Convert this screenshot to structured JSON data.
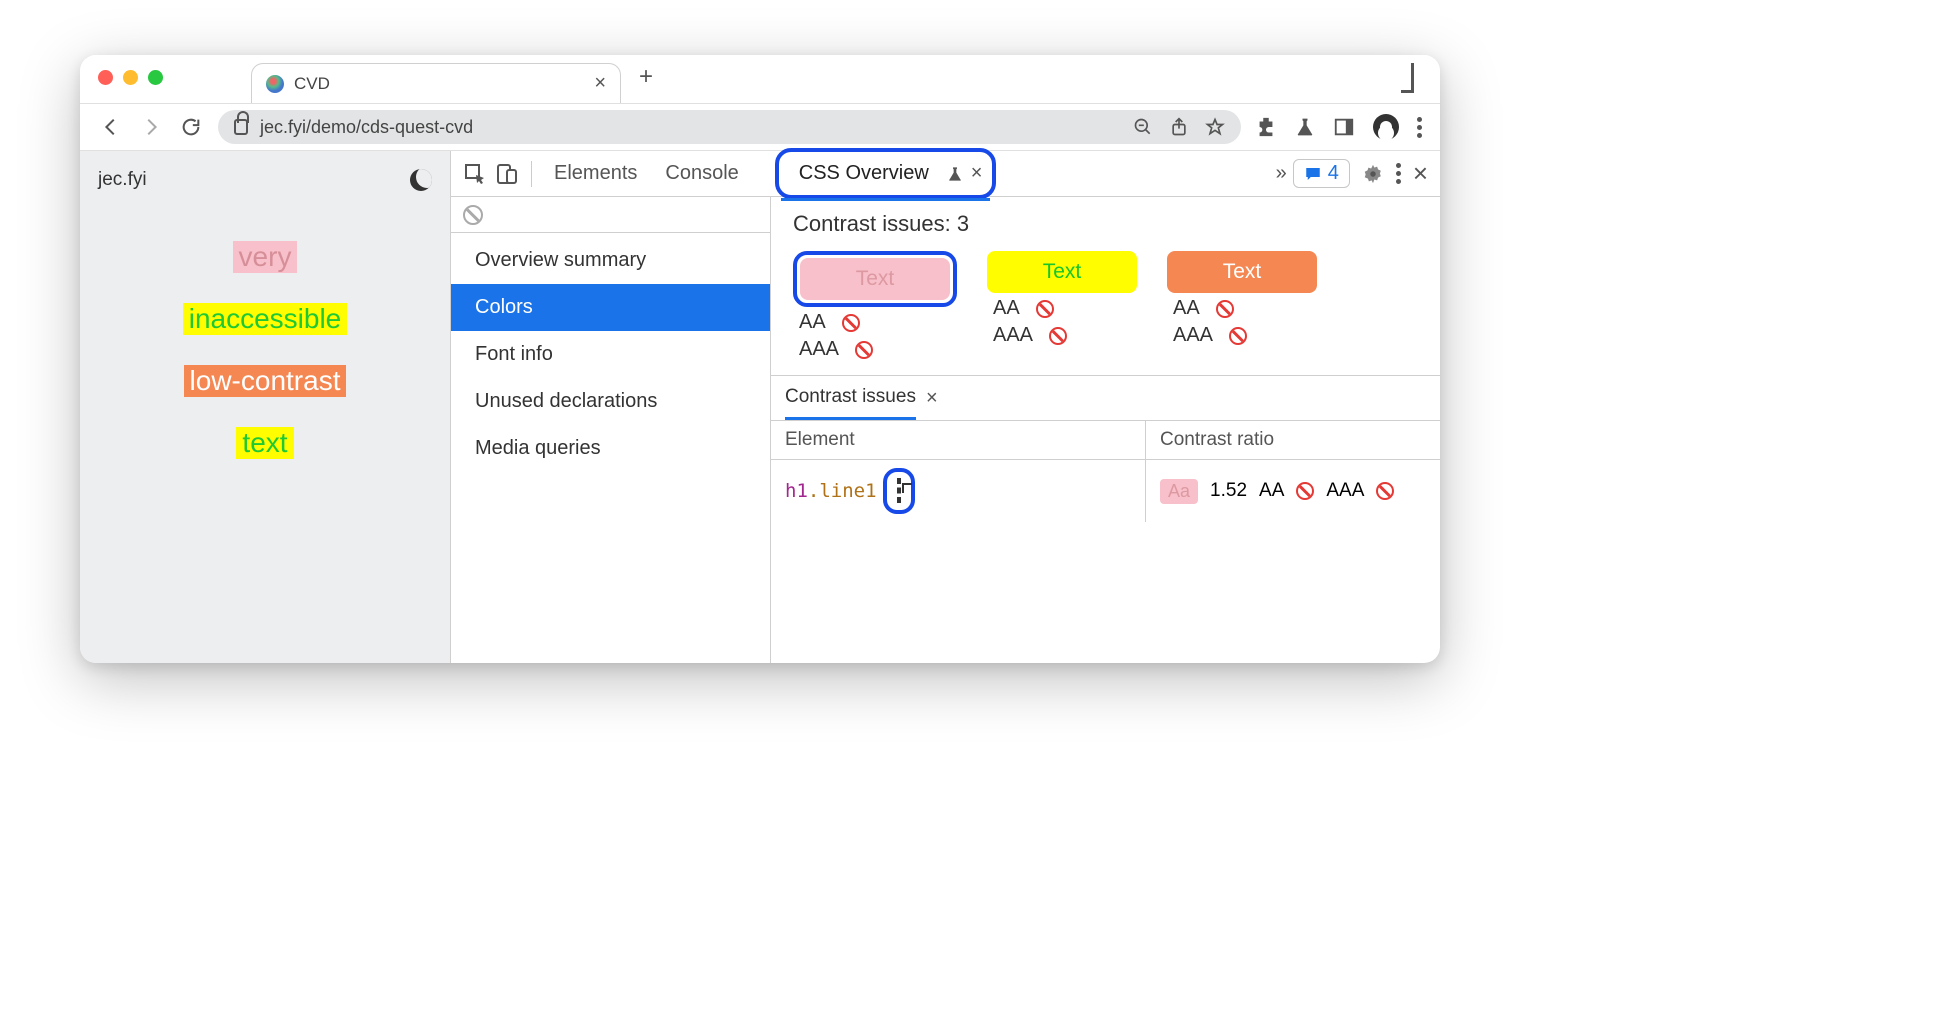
{
  "browser": {
    "tab_title": "CVD",
    "url_display": "jec.fyi/demo/cds-quest-cvd"
  },
  "page": {
    "site_label": "jec.fyi",
    "lines": {
      "l1": "very",
      "l2": "inaccessible",
      "l3": "low-contrast",
      "l4": "text"
    }
  },
  "devtools": {
    "tabs": {
      "elements": "Elements",
      "console": "Console",
      "css_overview": "CSS Overview"
    },
    "message_count": "4",
    "nav": {
      "summary": "Overview summary",
      "colors": "Colors",
      "font": "Font info",
      "unused": "Unused declarations",
      "media": "Media queries"
    },
    "contrast": {
      "header_prefix": "Contrast issues: ",
      "count": "3",
      "swatch_label": "Text",
      "aa": "AA",
      "aaa": "AAA"
    },
    "panel": {
      "tab_label": "Contrast issues",
      "col_element": "Element",
      "col_ratio": "Contrast ratio",
      "row": {
        "tag": "h1",
        "cls": ".line1",
        "aa_sample": "Aa",
        "ratio": "1.52",
        "aa": "AA",
        "aaa": "AAA"
      }
    }
  }
}
